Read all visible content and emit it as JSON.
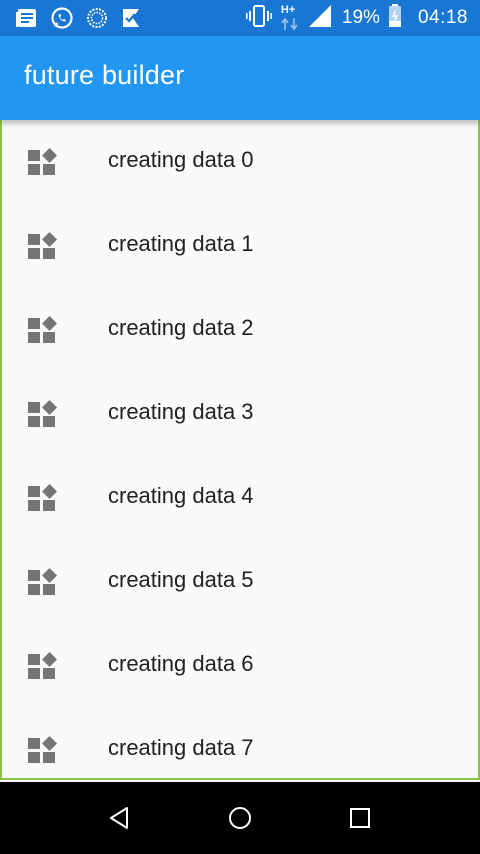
{
  "status_bar": {
    "battery_percent": "19%",
    "network_type": "H+",
    "time": "04:18",
    "icons_left": [
      "news-icon",
      "whatsapp-icon",
      "sync-circle-icon",
      "tasks-check-icon"
    ],
    "icons_right": [
      "vibrate-icon",
      "data-arrows-icon",
      "signal-icon",
      "battery-charging-icon"
    ]
  },
  "app_bar": {
    "title": "future builder",
    "color": "#2196f3"
  },
  "list": {
    "icon": "widgets-icon",
    "items": [
      "creating data 0",
      "creating data 1",
      "creating data 2",
      "creating data 3",
      "creating data 4",
      "creating data 5",
      "creating data 6",
      "creating data 7"
    ]
  },
  "nav_bar": {
    "buttons": [
      "back-icon",
      "home-icon",
      "recents-icon"
    ]
  }
}
